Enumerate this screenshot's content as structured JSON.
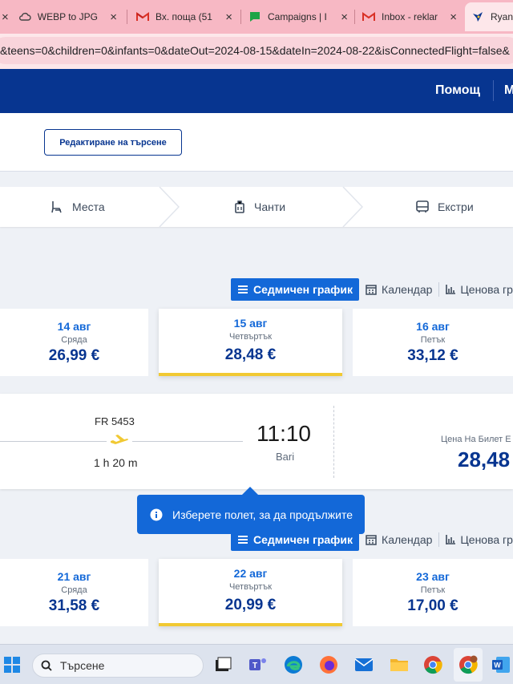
{
  "browser": {
    "tabs": [
      {
        "title": "WEBP to JPG",
        "icon": "cloud-icon"
      },
      {
        "title": "Вх. поща (51",
        "icon": "gmail-icon"
      },
      {
        "title": "Campaigns | I",
        "icon": "chat-icon"
      },
      {
        "title": "Inbox - reklar",
        "icon": "gmail-icon"
      },
      {
        "title": "Ryan",
        "icon": "ryanair-icon",
        "active": true
      }
    ],
    "tab_close": "×",
    "url": "&teens=0&children=0&infants=0&dateOut=2024-08-15&dateIn=2024-08-22&isConnectedFlight=false&"
  },
  "header": {
    "help": "Помощ",
    "more": "M"
  },
  "edit_search": {
    "label": "Редактиране на търсене"
  },
  "steps": [
    {
      "label": "Места",
      "icon": "seat-icon"
    },
    {
      "label": "Чанти",
      "icon": "bag-icon"
    },
    {
      "label": "Екстри",
      "icon": "bus-icon"
    }
  ],
  "view_toggle": {
    "weekly": "Седмичен график",
    "calendar": "Календар",
    "price_graph": "Ценова граф"
  },
  "outbound_dates": [
    {
      "date": "14 авг",
      "weekday": "Сряда",
      "price": "26,99 €"
    },
    {
      "date": "15 авг",
      "weekday": "Четвъртък",
      "price": "28,48 €",
      "selected": true
    },
    {
      "date": "16 авг",
      "weekday": "Петък",
      "price": "33,12 €"
    }
  ],
  "flight": {
    "number": "FR 5453",
    "duration": "1 h 20 m",
    "arrival_time": "11:10",
    "arrival_city": "Bari",
    "price_label": "Цена На Билет Е",
    "price": "28,48"
  },
  "tooltip": {
    "text": "Изберете полет, за да продължите"
  },
  "return_dates": [
    {
      "date": "21 авг",
      "weekday": "Сряда",
      "price": "31,58 €"
    },
    {
      "date": "22 авг",
      "weekday": "Четвъртък",
      "price": "20,99 €",
      "selected": true
    },
    {
      "date": "23 авг",
      "weekday": "Петък",
      "price": "17,00 €"
    }
  ],
  "taskbar": {
    "search_placeholder": "Търсене",
    "apps": [
      "windows-start-icon",
      "task-view-icon",
      "teams-icon",
      "edge-icon",
      "firefox-icon",
      "mail-icon",
      "file-explorer-icon",
      "chrome-icon",
      "chrome-profile-icon",
      "word-icon"
    ]
  },
  "colors": {
    "brand_navy": "#073590",
    "accent_blue": "#1368d8",
    "accent_yellow": "#f1c933"
  }
}
